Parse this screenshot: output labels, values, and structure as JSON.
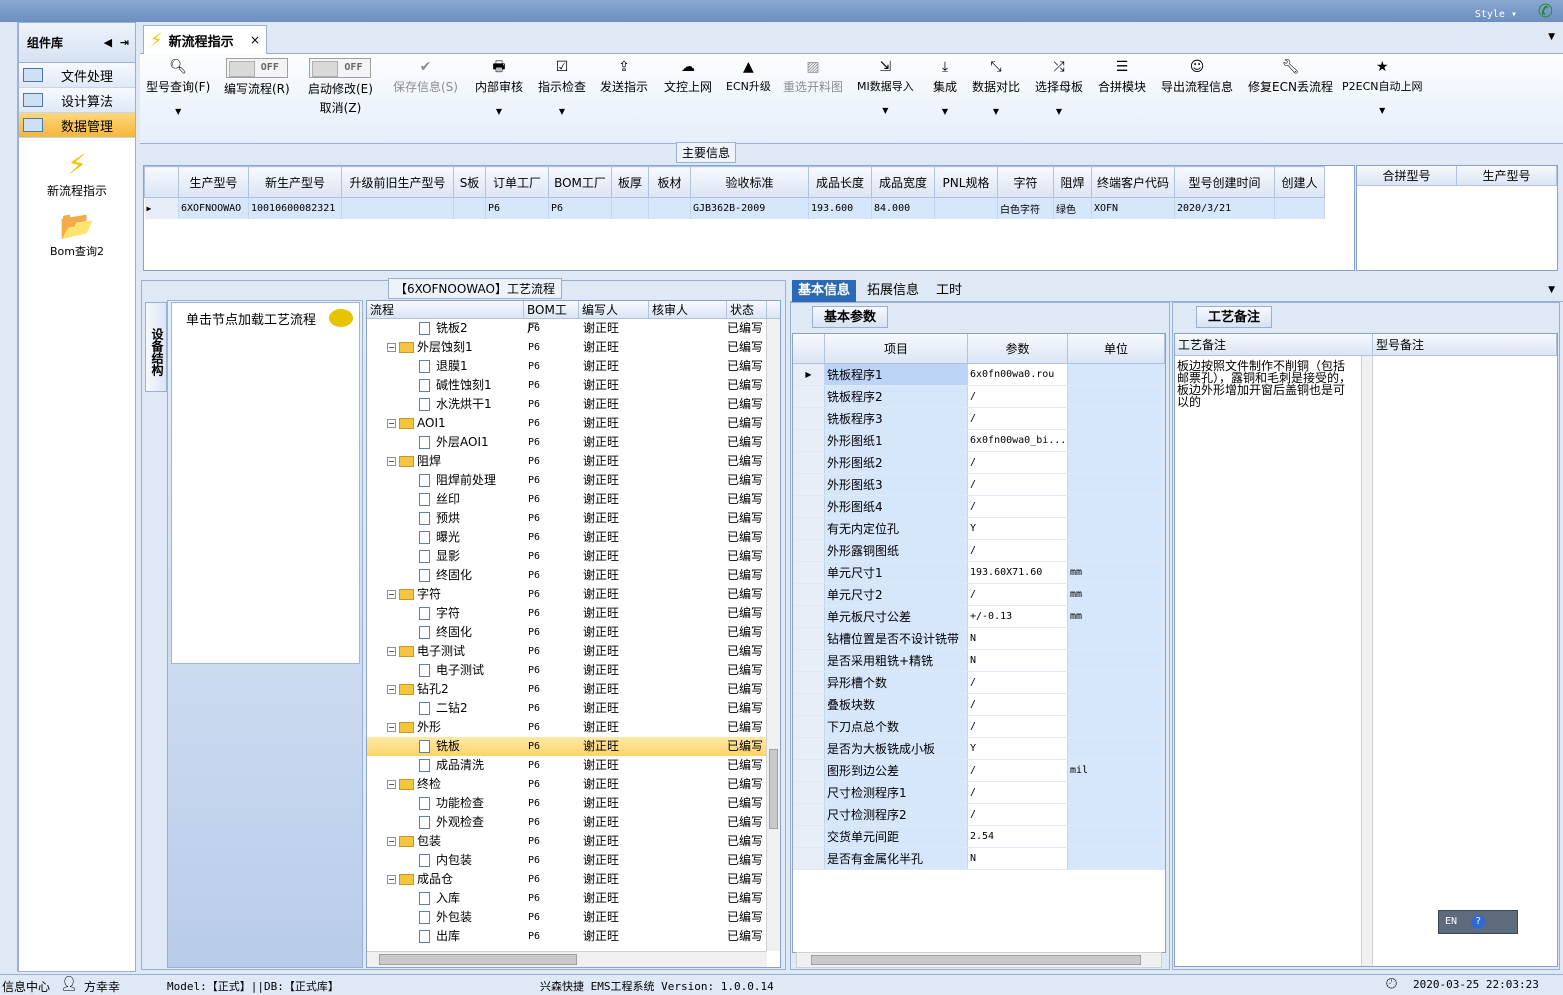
{
  "topbar": {
    "style_label": "Style ▾"
  },
  "components": {
    "title": "组件库",
    "items": [
      {
        "label": "文件处理",
        "active": false
      },
      {
        "label": "设计算法",
        "active": false
      },
      {
        "label": "数据管理",
        "active": true
      }
    ],
    "tools": [
      {
        "label": "新流程指示",
        "icon": "lightning-icon"
      },
      {
        "label": "Bom查询2",
        "icon": "folder-open-icon"
      }
    ]
  },
  "doc_tab": {
    "label": "新流程指示",
    "close": "×"
  },
  "ribbon": {
    "model_query": "型号查询(F)",
    "write_flow": "编写流程(R)",
    "write_flow_toggle": "OFF",
    "start_edit": "启动修改(E)",
    "start_edit_toggle": "OFF",
    "cancel": "取消(Z)",
    "save_info": "保存信息(S)",
    "internal_review": "内部审核",
    "instruction_check": "指示检查",
    "send_instruction": "发送指示",
    "cam_upload": "文控上网",
    "ecn_upgrade": "ECN升级",
    "redraw_cut": "重选开料图",
    "mi_import": "MI数据导入",
    "integrate": "集成",
    "data_compare": "数据对比",
    "select_mother": "选择母板",
    "combine_module": "合拼模块",
    "export_flow": "导出流程信息",
    "fix_ecn": "修复ECN丢流程",
    "p2ecn": "P2ECN自动上网"
  },
  "main_info": {
    "group_title": "主要信息",
    "columns": [
      "生产型号",
      "新生产型号",
      "升级前旧生产型号",
      "S板",
      "订单工厂",
      "BOM工厂",
      "板厚",
      "板材",
      "验收标准",
      "成品长度",
      "成品宽度",
      "PNL规格",
      "字符",
      "阻焊",
      "终端客户代码",
      "型号创建时间",
      "创建人"
    ],
    "row": [
      "6XOFNOOWAO",
      "10010600082321",
      "",
      "",
      "P6",
      "P6",
      "",
      "",
      "GJB362B-2009",
      "193.600",
      "84.000",
      "",
      "白色字符",
      "绿色",
      "XOFN",
      "2020/3/21",
      ""
    ],
    "side_columns": [
      "合拼型号",
      "生产型号"
    ]
  },
  "device": {
    "vtab": "设备结构",
    "hint": "单击节点加载工艺流程",
    "flow_title": "【6XOFNOOWAO】工艺流程"
  },
  "tree": {
    "columns": [
      "流程",
      "BOM工厂",
      "编写人",
      "核审人",
      "状态"
    ],
    "rows": [
      {
        "name": "铣板2",
        "level": 2,
        "folder": false,
        "bom": "P6",
        "writer": "谢正旺",
        "status": "已编写"
      },
      {
        "name": "外层蚀刻1",
        "level": 1,
        "folder": true,
        "bom": "P6",
        "writer": "谢正旺",
        "status": "已编写"
      },
      {
        "name": "退膜1",
        "level": 2,
        "folder": false,
        "bom": "P6",
        "writer": "谢正旺",
        "status": "已编写"
      },
      {
        "name": "碱性蚀刻1",
        "level": 2,
        "folder": false,
        "bom": "P6",
        "writer": "谢正旺",
        "status": "已编写"
      },
      {
        "name": "水洗烘干1",
        "level": 2,
        "folder": false,
        "bom": "P6",
        "writer": "谢正旺",
        "status": "已编写"
      },
      {
        "name": "AOI1",
        "level": 1,
        "folder": true,
        "bom": "P6",
        "writer": "谢正旺",
        "status": "已编写"
      },
      {
        "name": "外层AOI1",
        "level": 2,
        "folder": false,
        "bom": "P6",
        "writer": "谢正旺",
        "status": "已编写"
      },
      {
        "name": "阻焊",
        "level": 1,
        "folder": true,
        "bom": "P6",
        "writer": "谢正旺",
        "status": "已编写"
      },
      {
        "name": "阻焊前处理",
        "level": 2,
        "folder": false,
        "bom": "P6",
        "writer": "谢正旺",
        "status": "已编写"
      },
      {
        "name": "丝印",
        "level": 2,
        "folder": false,
        "bom": "P6",
        "writer": "谢正旺",
        "status": "已编写"
      },
      {
        "name": "预烘",
        "level": 2,
        "folder": false,
        "bom": "P6",
        "writer": "谢正旺",
        "status": "已编写"
      },
      {
        "name": "曝光",
        "level": 2,
        "folder": false,
        "bom": "P6",
        "writer": "谢正旺",
        "status": "已编写"
      },
      {
        "name": "显影",
        "level": 2,
        "folder": false,
        "bom": "P6",
        "writer": "谢正旺",
        "status": "已编写"
      },
      {
        "name": "终固化",
        "level": 2,
        "folder": false,
        "bom": "P6",
        "writer": "谢正旺",
        "status": "已编写"
      },
      {
        "name": "字符",
        "level": 1,
        "folder": true,
        "bom": "P6",
        "writer": "谢正旺",
        "status": "已编写"
      },
      {
        "name": "字符",
        "level": 2,
        "folder": false,
        "bom": "P6",
        "writer": "谢正旺",
        "status": "已编写"
      },
      {
        "name": "终固化",
        "level": 2,
        "folder": false,
        "bom": "P6",
        "writer": "谢正旺",
        "status": "已编写"
      },
      {
        "name": "电子测试",
        "level": 1,
        "folder": true,
        "bom": "P6",
        "writer": "谢正旺",
        "status": "已编写"
      },
      {
        "name": "电子测试",
        "level": 2,
        "folder": false,
        "bom": "P6",
        "writer": "谢正旺",
        "status": "已编写"
      },
      {
        "name": "钻孔2",
        "level": 1,
        "folder": true,
        "bom": "P6",
        "writer": "谢正旺",
        "status": "已编写"
      },
      {
        "name": "二钻2",
        "level": 2,
        "folder": false,
        "bom": "P6",
        "writer": "谢正旺",
        "status": "已编写"
      },
      {
        "name": "外形",
        "level": 1,
        "folder": true,
        "bom": "P6",
        "writer": "谢正旺",
        "status": "已编写"
      },
      {
        "name": "铣板",
        "level": 2,
        "folder": false,
        "bom": "P6",
        "writer": "谢正旺",
        "status": "已编写",
        "selected": true
      },
      {
        "name": "成品清洗",
        "level": 2,
        "folder": false,
        "bom": "P6",
        "writer": "谢正旺",
        "status": "已编写"
      },
      {
        "name": "终检",
        "level": 1,
        "folder": true,
        "bom": "P6",
        "writer": "谢正旺",
        "status": "已编写"
      },
      {
        "name": "功能检查",
        "level": 2,
        "folder": false,
        "bom": "P6",
        "writer": "谢正旺",
        "status": "已编写"
      },
      {
        "name": "外观检查",
        "level": 2,
        "folder": false,
        "bom": "P6",
        "writer": "谢正旺",
        "status": "已编写"
      },
      {
        "name": "包装",
        "level": 1,
        "folder": true,
        "bom": "P6",
        "writer": "谢正旺",
        "status": "已编写"
      },
      {
        "name": "内包装",
        "level": 2,
        "folder": false,
        "bom": "P6",
        "writer": "谢正旺",
        "status": "已编写"
      },
      {
        "name": "成品仓",
        "level": 1,
        "folder": true,
        "bom": "P6",
        "writer": "谢正旺",
        "status": "已编写"
      },
      {
        "name": "入库",
        "level": 2,
        "folder": false,
        "bom": "P6",
        "writer": "谢正旺",
        "status": "已编写"
      },
      {
        "name": "外包装",
        "level": 2,
        "folder": false,
        "bom": "P6",
        "writer": "谢正旺",
        "status": "已编写"
      },
      {
        "name": "出库",
        "level": 2,
        "folder": false,
        "bom": "P6",
        "writer": "谢正旺",
        "status": "已编写"
      }
    ]
  },
  "right_tabs": [
    "基本信息",
    "拓展信息",
    "工时"
  ],
  "basic": {
    "sub_tab": "基本参数",
    "columns": [
      "项目",
      "参数",
      "单位"
    ],
    "rows": [
      {
        "k": "铣板程序1",
        "v": "6x0fn00wa0.rou",
        "u": ""
      },
      {
        "k": "铣板程序2",
        "v": "/",
        "u": ""
      },
      {
        "k": "铣板程序3",
        "v": "/",
        "u": ""
      },
      {
        "k": "外形图纸1",
        "v": "6x0fn00wa0_bi...",
        "u": ""
      },
      {
        "k": "外形图纸2",
        "v": "/",
        "u": ""
      },
      {
        "k": "外形图纸3",
        "v": "/",
        "u": ""
      },
      {
        "k": "外形图纸4",
        "v": "/",
        "u": ""
      },
      {
        "k": "有无内定位孔",
        "v": "Y",
        "u": ""
      },
      {
        "k": "外形露铜图纸",
        "v": "/",
        "u": ""
      },
      {
        "k": "单元尺寸1",
        "v": "193.60X71.60",
        "u": "mm"
      },
      {
        "k": "单元尺寸2",
        "v": "/",
        "u": "mm"
      },
      {
        "k": "单元板尺寸公差",
        "v": "+/-0.13",
        "u": "mm"
      },
      {
        "k": "钻槽位置是否不设计铣带",
        "v": "N",
        "u": ""
      },
      {
        "k": "是否采用粗铣+精铣",
        "v": "N",
        "u": ""
      },
      {
        "k": "异形槽个数",
        "v": "/",
        "u": ""
      },
      {
        "k": "叠板块数",
        "v": "/",
        "u": ""
      },
      {
        "k": "下刀点总个数",
        "v": "/",
        "u": ""
      },
      {
        "k": "是否为大板铣成小板",
        "v": "Y",
        "u": ""
      },
      {
        "k": "图形到边公差",
        "v": "/",
        "u": "mil"
      },
      {
        "k": "尺寸检测程序1",
        "v": "/",
        "u": ""
      },
      {
        "k": "尺寸检测程序2",
        "v": "/",
        "u": ""
      },
      {
        "k": "交货单元间距",
        "v": "2.54",
        "u": ""
      },
      {
        "k": "是否有金属化半孔",
        "v": "N",
        "u": ""
      }
    ]
  },
  "remarks": {
    "tab": "工艺备注",
    "columns": [
      "工艺备注",
      "型号备注"
    ],
    "text": "板边按照文件制作不削铜（包括邮票孔），露铜和毛刺是接受的，板边外形增加开窗后盖铜也是可以的"
  },
  "ime": {
    "lang": "EN",
    "help": "?"
  },
  "status": {
    "info_center": "信息中心",
    "user": "方幸幸",
    "model_db": "Model:【正式】||DB:【正式库】",
    "system": "兴森快捷 EMS工程系统 Version: 1.0.0.14",
    "datetime": "2020-03-25 22:03:23"
  }
}
